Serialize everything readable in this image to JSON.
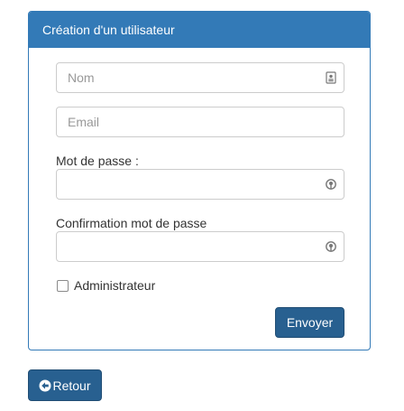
{
  "panel": {
    "title": "Création d'un utilisateur"
  },
  "form": {
    "name": {
      "placeholder": "Nom",
      "value": "",
      "icon": "contact-card-icon"
    },
    "email": {
      "placeholder": "Email",
      "value": ""
    },
    "password": {
      "label": "Mot de passe :",
      "value": "",
      "icon": "key-icon"
    },
    "password_confirm": {
      "label": "Confirmation mot de passe",
      "value": "",
      "icon": "key-icon"
    },
    "admin": {
      "label": "Administrateur",
      "checked": false
    },
    "submit_label": "Envoyer"
  },
  "back_button": {
    "label": "Retour",
    "icon": "circle-arrow-left-icon"
  },
  "colors": {
    "primary": "#337ab7",
    "button": "#286090",
    "border": "#cccccc"
  }
}
